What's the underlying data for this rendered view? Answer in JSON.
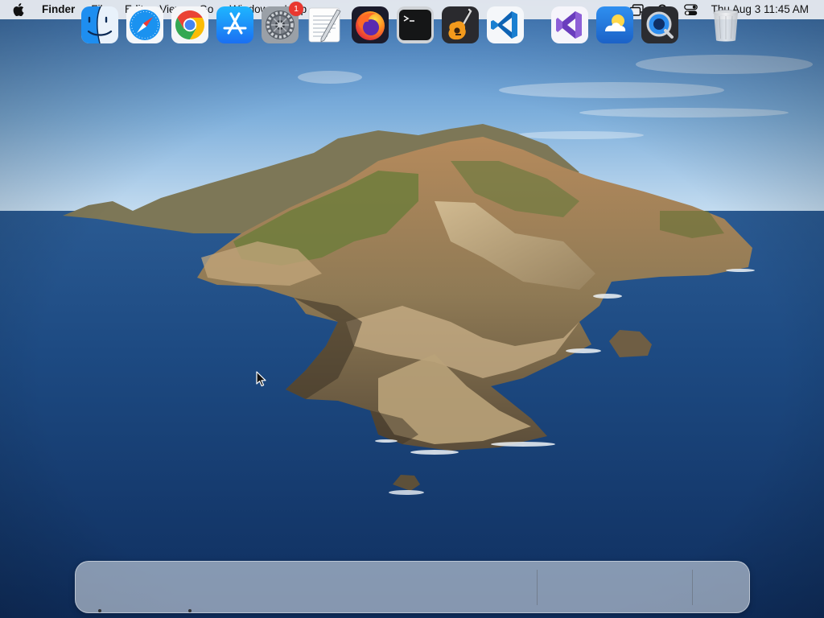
{
  "menubar": {
    "apple_icon": "apple-logo-icon",
    "app_name": "Finder",
    "menus": [
      "File",
      "Edit",
      "View",
      "Go",
      "Window",
      "Help"
    ],
    "status_icons": [
      "screen-mirroring-icon",
      "spotlight-search-icon",
      "control-center-icon"
    ],
    "clock": "Thu Aug 3  11:45 AM"
  },
  "desktop": {
    "wallpaper": "macOS Catalina island",
    "colors": {
      "sky_top": "#4a86c8",
      "sky_horizon": "#b8d6ee",
      "ocean": "#1c4a80",
      "ocean_deep": "#0e2c5a"
    }
  },
  "dock": {
    "apps": [
      {
        "name": "Finder",
        "icon": "finder-icon",
        "running": true
      },
      {
        "name": "Safari",
        "icon": "safari-icon",
        "running": false
      },
      {
        "name": "Google Chrome",
        "icon": "chrome-icon",
        "running": true
      },
      {
        "name": "App Store",
        "icon": "app-store-icon",
        "running": false
      },
      {
        "name": "System Preferences",
        "icon": "system-preferences-icon",
        "running": false,
        "badge": "1"
      },
      {
        "name": "TextEdit",
        "icon": "textedit-icon",
        "running": false
      },
      {
        "name": "Firefox",
        "icon": "firefox-icon",
        "running": false
      },
      {
        "name": "Terminal",
        "icon": "terminal-icon",
        "running": false
      },
      {
        "name": "GarageBand",
        "icon": "garageband-icon",
        "running": false
      },
      {
        "name": "Visual Studio Code",
        "icon": "vscode-icon",
        "running": false
      }
    ],
    "recent_apps": [
      {
        "name": "Visual Studio",
        "icon": "visual-studio-icon",
        "running": false
      },
      {
        "name": "Weather",
        "icon": "weather-icon",
        "running": false
      },
      {
        "name": "QuickTime Player",
        "icon": "quicktime-icon",
        "running": false
      }
    ],
    "trash": {
      "name": "Trash",
      "icon": "trash-icon"
    },
    "system_preferences_badge": "1"
  }
}
